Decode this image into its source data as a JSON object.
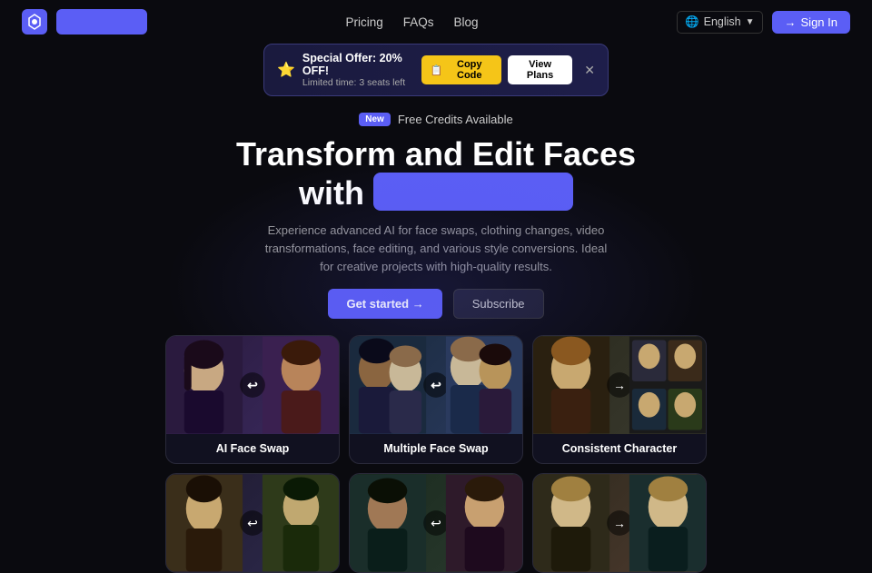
{
  "navbar": {
    "logo_alt": "App Logo",
    "nav_links": [
      "Pricing",
      "FAQs",
      "Blog"
    ],
    "lang_label": "English",
    "sign_in_label": "Sign In"
  },
  "promo": {
    "star": "⭐",
    "title": "Special Offer: 20% OFF!",
    "subtitle": "Limited time: 3 seats left",
    "copy_code": "Copy Code",
    "view_plans": "View Plans"
  },
  "hero": {
    "badge": "New",
    "free_credits": "Free Credits Available",
    "title_line1": "Transform and Edit Faces",
    "title_line2": "with",
    "title_highlight": "",
    "description": "Experience advanced AI for face swaps, clothing changes, video transformations, face editing, and various style conversions. Ideal for creative projects with high-quality results.",
    "get_started": "Get started →",
    "subscribe": "Subscribe"
  },
  "feature_cards": [
    {
      "id": "ai-face-swap",
      "label": "AI Face Swap"
    },
    {
      "id": "multiple-face-swap",
      "label": "Multiple Face Swap"
    },
    {
      "id": "consistent-character",
      "label": "Consistent Character"
    }
  ],
  "bottom_cards": [
    {
      "id": "card-b1",
      "label": ""
    },
    {
      "id": "card-b2",
      "label": ""
    },
    {
      "id": "card-b3",
      "label": ""
    }
  ],
  "colors": {
    "accent": "#5b5ef5",
    "promo_gold": "#f5c518",
    "bg": "#0a0a0f"
  }
}
